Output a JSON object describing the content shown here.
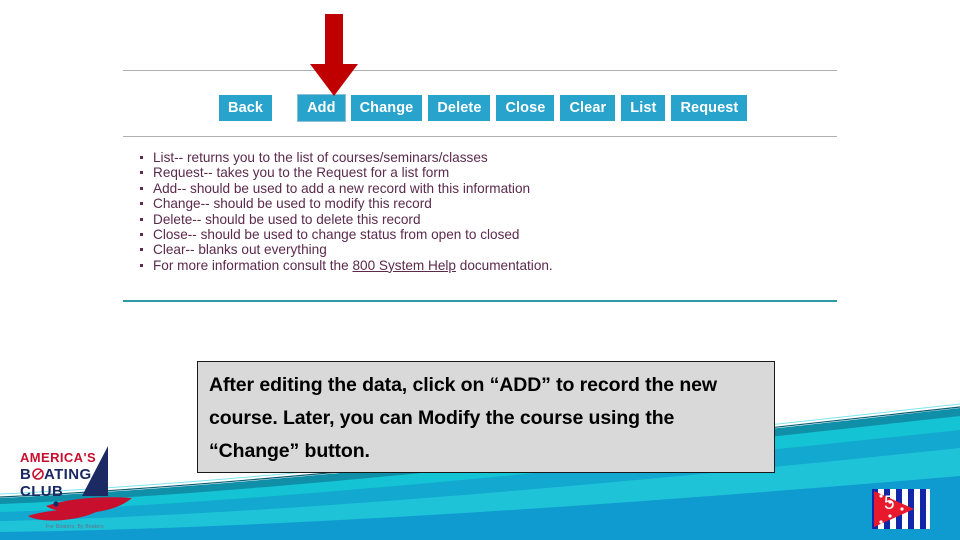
{
  "slide": {
    "number": "5",
    "background_color": "#ffffff",
    "accent_teal": "#1bb8c8",
    "accent_blue": "#0c9fd4"
  },
  "toolbar": {
    "name": "form-action-buttons",
    "button_color": "#27a3cc",
    "button_text_color": "#ffffff",
    "buttons": [
      {
        "label": "Back",
        "highlighted": false
      },
      {
        "label": "Add",
        "highlighted": true
      },
      {
        "label": "Change",
        "highlighted": false
      },
      {
        "label": "Delete",
        "highlighted": false
      },
      {
        "label": "Close",
        "highlighted": false
      },
      {
        "label": "Clear",
        "highlighted": false
      },
      {
        "label": "List",
        "highlighted": false
      },
      {
        "label": "Request",
        "highlighted": false
      }
    ]
  },
  "annotation": {
    "arrow_color": "#c00000",
    "points_at": "Add"
  },
  "help_list": {
    "text_color": "#5b2a4d",
    "items": [
      {
        "text": "List-- returns you to the list of courses/seminars/classes"
      },
      {
        "text": "Request-- takes you to the Request for a list form"
      },
      {
        "text": "Add-- should be used to add a new record with this information"
      },
      {
        "text": "Change-- should be used to modify this record"
      },
      {
        "text": "Delete-- should be used to delete this record"
      },
      {
        "text": "Close-- should be used to change status from open to closed"
      },
      {
        "text": "Clear-- blanks out everything"
      }
    ],
    "last_item": {
      "prefix": "For more information consult the ",
      "link": "800 System Help",
      "suffix": " documentation."
    }
  },
  "caption": {
    "text": "After editing the data, click on “ADD” to record the new course.  Later, you can Modify the course using the “Change” button.",
    "background_color": "#d9d9d9",
    "border_color": "#1a1a1a"
  },
  "logo": {
    "line1": "AMERICA'S",
    "line2": "BØATING",
    "line3": "CLUB",
    "tagline": "For Boaters, By Boaters",
    "red": "#c8102e",
    "navy": "#1b2a63"
  }
}
